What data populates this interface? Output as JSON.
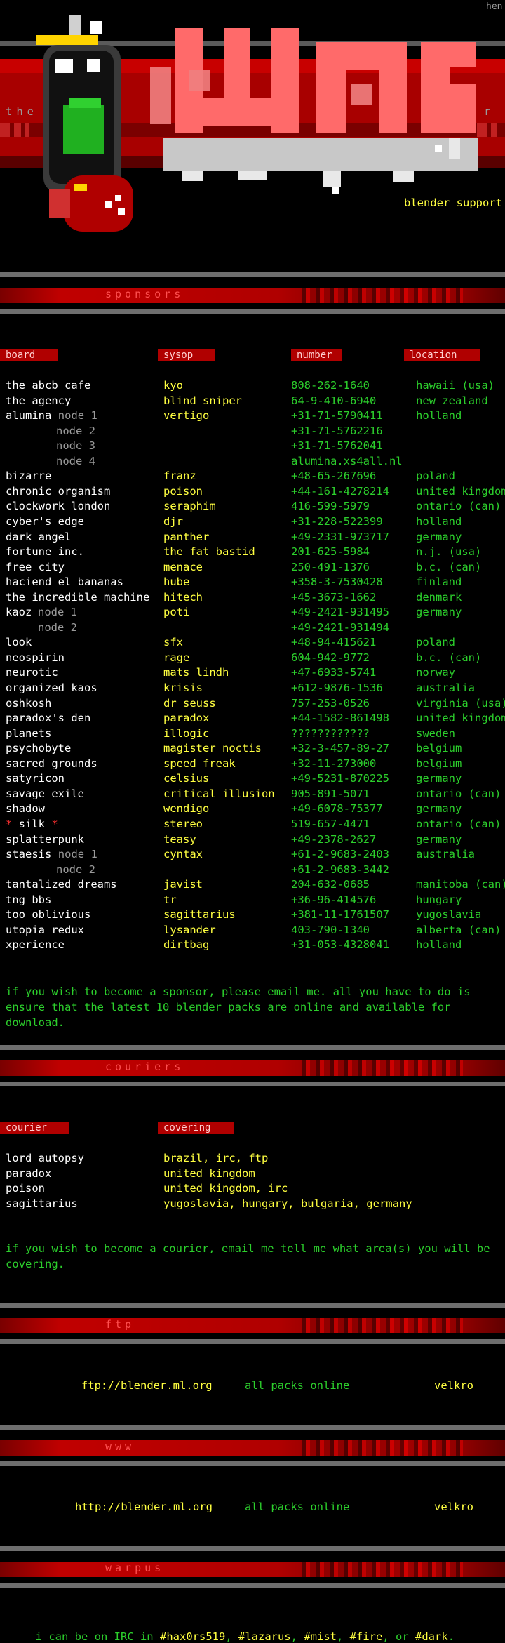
{
  "corner_tag": "hen",
  "logo": {
    "left_word": "the",
    "right_letter": "r",
    "tagline": "blender support"
  },
  "sponsors": {
    "title": "sponsors",
    "headers": [
      "board",
      "sysop",
      "number",
      "location"
    ],
    "rows": [
      {
        "board": "the abcb cafe",
        "node": "",
        "sysop": "kyo",
        "number": "808-262-1640",
        "location": "hawaii (usa)"
      },
      {
        "board": "the agency",
        "node": "",
        "sysop": "blind sniper",
        "number": "64-9-410-6940",
        "location": "new zealand"
      },
      {
        "board": "alumina",
        "node": "node 1",
        "sysop": "vertigo",
        "number": "+31-71-5790411",
        "location": "holland"
      },
      {
        "board": "",
        "node": "node 2",
        "sysop": "",
        "number": "+31-71-5762216",
        "location": ""
      },
      {
        "board": "",
        "node": "node 3",
        "sysop": "",
        "number": "+31-71-5762041",
        "location": ""
      },
      {
        "board": "",
        "node": "node 4",
        "sysop": "",
        "number": "alumina.xs4all.nl",
        "location": ""
      },
      {
        "board": "bizarre",
        "node": "",
        "sysop": "franz",
        "number": "+48-65-267696",
        "location": "poland"
      },
      {
        "board": "chronic organism",
        "node": "",
        "sysop": "poison",
        "number": "+44-161-4278214",
        "location": "united kingdom"
      },
      {
        "board": "clockwork london",
        "node": "",
        "sysop": "seraphim",
        "number": "416-599-5979",
        "location": "ontario (can)"
      },
      {
        "board": "cyber's edge",
        "node": "",
        "sysop": "djr",
        "number": "+31-228-522399",
        "location": "holland"
      },
      {
        "board": "dark angel",
        "node": "",
        "sysop": "panther",
        "number": "+49-2331-973717",
        "location": "germany"
      },
      {
        "board": "fortune inc.",
        "node": "",
        "sysop": "the fat bastid",
        "number": "201-625-5984",
        "location": "n.j. (usa)"
      },
      {
        "board": "free city",
        "node": "",
        "sysop": "menace",
        "number": "250-491-1376",
        "location": "b.c. (can)"
      },
      {
        "board": "haciend el bananas",
        "node": "",
        "sysop": "hube",
        "number": "+358-3-7530428",
        "location": "finland"
      },
      {
        "board": "the incredible machine",
        "node": "",
        "sysop": "hitech",
        "number": "+45-3673-1662",
        "location": "denmark"
      },
      {
        "board": "kaoz",
        "node": "node 1",
        "sysop": "poti",
        "number": "+49-2421-931495",
        "location": "germany"
      },
      {
        "board": "",
        "node": "node 2",
        "sysop": "",
        "number": "+49-2421-931494",
        "location": ""
      },
      {
        "board": "look",
        "node": "",
        "sysop": "sfx",
        "number": "+48-94-415621",
        "location": "poland"
      },
      {
        "board": "neospirin",
        "node": "",
        "sysop": "rage",
        "number": "604-942-9772",
        "location": "b.c. (can)"
      },
      {
        "board": "neurotic",
        "node": "",
        "sysop": "mats lindh",
        "number": "+47-6933-5741",
        "location": "norway"
      },
      {
        "board": "organized kaos",
        "node": "",
        "sysop": "krisis",
        "number": "+612-9876-1536",
        "location": "australia"
      },
      {
        "board": "oshkosh",
        "node": "",
        "sysop": "dr seuss",
        "number": "757-253-0526",
        "location": "virginia (usa)"
      },
      {
        "board": "paradox's den",
        "node": "",
        "sysop": "paradox",
        "number": "+44-1582-861498",
        "location": "united kingdom"
      },
      {
        "board": "planets",
        "node": "",
        "sysop": "illogic",
        "number": "????????????",
        "location": "sweden"
      },
      {
        "board": "psychobyte",
        "node": "",
        "sysop": "magister noctis",
        "number": "+32-3-457-89-27",
        "location": "belgium"
      },
      {
        "board": "sacred grounds",
        "node": "",
        "sysop": "speed freak",
        "number": "+32-11-273000",
        "location": "belgium"
      },
      {
        "board": "satyricon",
        "node": "",
        "sysop": "celsius",
        "number": "+49-5231-870225",
        "location": "germany"
      },
      {
        "board": "savage exile",
        "node": "",
        "sysop": "critical illusion",
        "number": "905-891-5071",
        "location": "ontario (can)"
      },
      {
        "board": "shadow",
        "node": "",
        "sysop": "wendigo",
        "number": "+49-6078-75377",
        "location": "germany"
      },
      {
        "board": "silk",
        "node": "",
        "sysop": "stereo",
        "number": "519-657-4471",
        "location": "ontario (can)",
        "starred": true
      },
      {
        "board": "splatterpunk",
        "node": "",
        "sysop": "teasy",
        "number": "+49-2378-2627",
        "location": "germany"
      },
      {
        "board": "staesis",
        "node": "node 1",
        "sysop": "cyntax",
        "number": "+61-2-9683-2403",
        "location": "australia"
      },
      {
        "board": "",
        "node": "node 2",
        "sysop": "",
        "number": "+61-2-9683-3442",
        "location": ""
      },
      {
        "board": "tantalized dreams",
        "node": "",
        "sysop": "javist",
        "number": "204-632-0685",
        "location": "manitoba (can)"
      },
      {
        "board": "tng bbs",
        "node": "",
        "sysop": "tr",
        "number": "+36-96-414576",
        "location": "hungary"
      },
      {
        "board": "too oblivious",
        "node": "",
        "sysop": "sagittarius",
        "number": "+381-11-1761507",
        "location": "yugoslavia"
      },
      {
        "board": "utopia redux",
        "node": "",
        "sysop": "lysander",
        "number": "403-790-1340",
        "location": "alberta (can)"
      },
      {
        "board": "xperience",
        "node": "",
        "sysop": "dirtbag",
        "number": "+31-053-4328041",
        "location": "holland"
      }
    ],
    "note": "if you wish to become a sponsor, please email me.  all you have to do is ensure that the latest 10 blender packs are online and available for download."
  },
  "couriers": {
    "title": "couriers",
    "headers": [
      "courier",
      "covering"
    ],
    "rows": [
      {
        "courier": "lord autopsy",
        "covering": "brazil, irc, ftp"
      },
      {
        "courier": "paradox",
        "covering": "united kingdom"
      },
      {
        "courier": "poison",
        "covering": "united kingdom, irc"
      },
      {
        "courier": "sagittarius",
        "covering": "yugoslavia, hungary, bulgaria, germany"
      }
    ],
    "note": "if you wish to become a courier, email me tell me what area(s) you will be covering."
  },
  "ftp": {
    "title": "ftp",
    "url": "ftp://blender.ml.org",
    "status": "all packs online",
    "owner": "velkro"
  },
  "www": {
    "title": "www",
    "url": "http://blender.ml.org",
    "status": "all packs online",
    "owner": "velkro"
  },
  "warpus": {
    "title": "warpus",
    "irc_prefix": "i can be on IRC in",
    "channels": [
      "#hax0rs519",
      "#lazarus",
      "#mist",
      "#fire",
      "#dark"
    ]
  },
  "colors": {
    "background": "#000000",
    "board_text": "#ffffff",
    "sysop_text": "#ffff40",
    "number_text": "#2ccf2c",
    "header_bg": "#b00000",
    "star": "#ff3030"
  }
}
